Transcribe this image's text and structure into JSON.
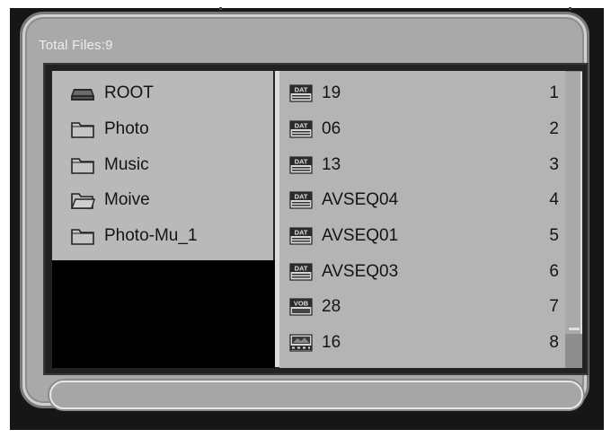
{
  "header": {
    "total_files": "Total Files:9"
  },
  "folders": [
    {
      "label": "ROOT",
      "icon": "drive-icon"
    },
    {
      "label": "Photo",
      "icon": "folder-icon"
    },
    {
      "label": "Music",
      "icon": "folder-icon"
    },
    {
      "label": "Moive",
      "icon": "folder-open-icon"
    },
    {
      "label": "Photo-Mu_1",
      "icon": "folder-icon"
    }
  ],
  "files": [
    {
      "label": "19",
      "index": "1",
      "icon": "dat-file-icon"
    },
    {
      "label": "06",
      "index": "2",
      "icon": "dat-file-icon"
    },
    {
      "label": "13",
      "index": "3",
      "icon": "dat-file-icon"
    },
    {
      "label": "AVSEQ04",
      "index": "4",
      "icon": "dat-file-icon"
    },
    {
      "label": "AVSEQ01",
      "index": "5",
      "icon": "dat-file-icon"
    },
    {
      "label": "AVSEQ03",
      "index": "6",
      "icon": "dat-file-icon"
    },
    {
      "label": "28",
      "index": "7",
      "icon": "vob-file-icon"
    },
    {
      "label": "16",
      "index": "8",
      "icon": "video-file-icon"
    }
  ],
  "colors": {
    "panel": "#a9a9a9",
    "file_pane": "#b4b4b4",
    "folder_pane": "#b9b9b9"
  }
}
